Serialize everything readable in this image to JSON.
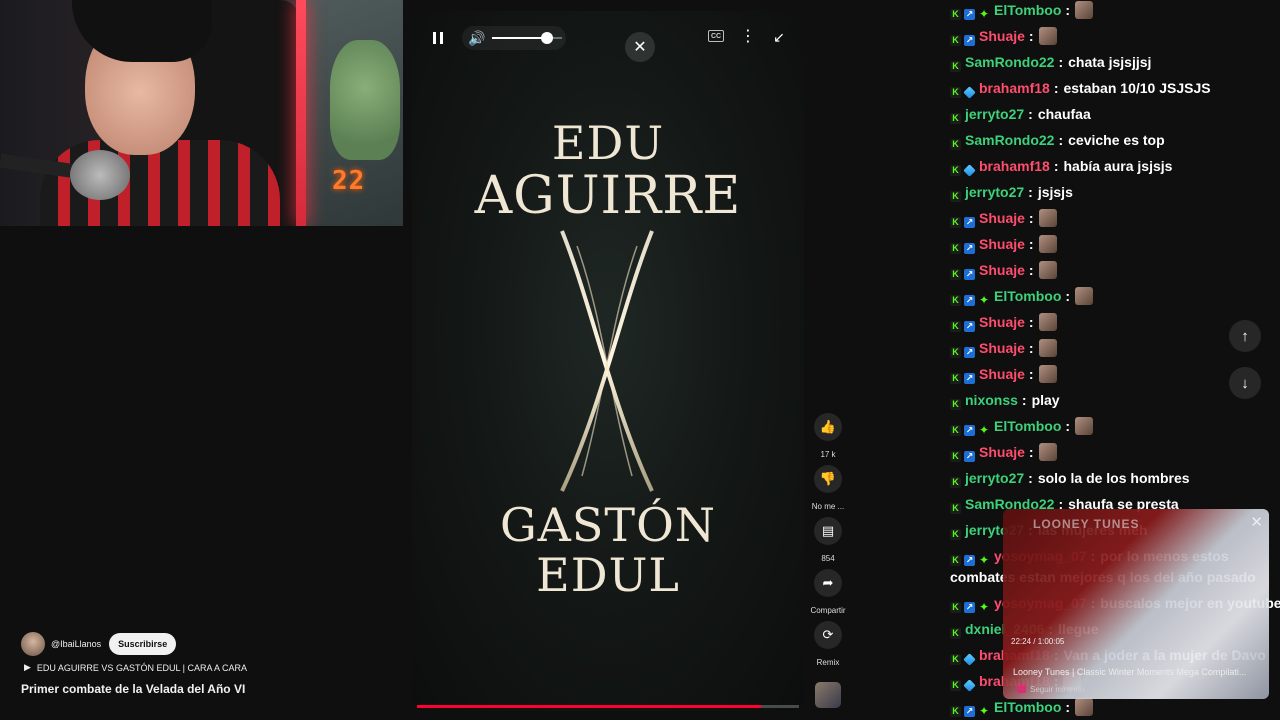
{
  "webcam": {
    "counter": "22"
  },
  "player": {
    "poster": {
      "line1": "EDU",
      "line2": "AGUIRRE",
      "line3": "GASTÓN",
      "line4": "EDUL"
    },
    "volume_level": 0.78,
    "progress": 0.9,
    "cc_label": "CC"
  },
  "actions": {
    "like_count": "17 k",
    "dislike_label": "No me ...",
    "comments_count": "854",
    "share_label": "Compartir",
    "remix_label": "Remix"
  },
  "channel": {
    "handle": "@IbaiLlanos",
    "subscribe_label": "Suscribirse",
    "playlist": "EDU AGUIRRE VS GASTÓN EDUL | CARA A CARA",
    "title": "Primer combate de la Velada del Año VI"
  },
  "chat": {
    "messages": [
      {
        "user": "ElTomboo",
        "color": "#3cd17a",
        "badges": [
          "k",
          "mod",
          "star"
        ],
        "text": "",
        "emote": true
      },
      {
        "user": "Shuaje",
        "color": "#ff4d6d",
        "badges": [
          "k",
          "mod"
        ],
        "text": "",
        "emote": true
      },
      {
        "user": "SamRondo22",
        "color": "#3cd17a",
        "badges": [
          "k"
        ],
        "text": "chata jsjsjjsj",
        "emote": false
      },
      {
        "user": "brahamf18",
        "color": "#ff4d6d",
        "badges": [
          "k",
          "cube"
        ],
        "text": "estaban 10/10 JSJSJS",
        "emote": false
      },
      {
        "user": "jerryto27",
        "color": "#3cd17a",
        "badges": [
          "k"
        ],
        "text": "chaufaa",
        "emote": false
      },
      {
        "user": "SamRondo22",
        "color": "#3cd17a",
        "badges": [
          "k"
        ],
        "text": "ceviche es top",
        "emote": false
      },
      {
        "user": "brahamf18",
        "color": "#ff4d6d",
        "badges": [
          "k",
          "cube"
        ],
        "text": "había aura jsjsjs",
        "emote": false
      },
      {
        "user": "jerryto27",
        "color": "#3cd17a",
        "badges": [
          "k"
        ],
        "text": "jsjsjs",
        "emote": false
      },
      {
        "user": "Shuaje",
        "color": "#ff4d6d",
        "badges": [
          "k",
          "mod"
        ],
        "text": "",
        "emote": true
      },
      {
        "user": "Shuaje",
        "color": "#ff4d6d",
        "badges": [
          "k",
          "mod"
        ],
        "text": "",
        "emote": true
      },
      {
        "user": "Shuaje",
        "color": "#ff4d6d",
        "badges": [
          "k",
          "mod"
        ],
        "text": "",
        "emote": true
      },
      {
        "user": "ElTomboo",
        "color": "#3cd17a",
        "badges": [
          "k",
          "mod",
          "star"
        ],
        "text": "",
        "emote": true
      },
      {
        "user": "Shuaje",
        "color": "#ff4d6d",
        "badges": [
          "k",
          "mod"
        ],
        "text": "",
        "emote": true
      },
      {
        "user": "Shuaje",
        "color": "#ff4d6d",
        "badges": [
          "k",
          "mod"
        ],
        "text": "",
        "emote": true
      },
      {
        "user": "Shuaje",
        "color": "#ff4d6d",
        "badges": [
          "k",
          "mod"
        ],
        "text": "",
        "emote": true
      },
      {
        "user": "nixonss",
        "color": "#3cd17a",
        "badges": [
          "k"
        ],
        "text": "play",
        "emote": false
      },
      {
        "user": "ElTomboo",
        "color": "#3cd17a",
        "badges": [
          "k",
          "mod",
          "star"
        ],
        "text": "",
        "emote": true
      },
      {
        "user": "Shuaje",
        "color": "#ff4d6d",
        "badges": [
          "k",
          "mod"
        ],
        "text": "",
        "emote": true
      },
      {
        "user": "jerryto27",
        "color": "#3cd17a",
        "badges": [
          "k"
        ],
        "text": "solo la de los hombres",
        "emote": false
      },
      {
        "user": "SamRondo22",
        "color": "#3cd17a",
        "badges": [
          "k"
        ],
        "text": "shaufa se presta",
        "emote": false
      },
      {
        "user": "jerryto27",
        "color": "#3cd17a",
        "badges": [
          "k"
        ],
        "text": "las mujeres meh",
        "emote": false
      },
      {
        "user": "yosoymag_07",
        "color": "#ff4d6d",
        "badges": [
          "k",
          "mod",
          "star"
        ],
        "text": "por lo menos estos",
        "emote": false
      },
      {
        "user": "yosoymag_07",
        "color": "#ff4d6d",
        "badges": [
          "k",
          "mod",
          "star"
        ],
        "text": "buscalos mejor en youtube",
        "emote": false
      },
      {
        "user": "dxniel_2406",
        "color": "#3cd17a",
        "badges": [
          "k"
        ],
        "text": "llegue",
        "emote": false
      },
      {
        "user": "brahamf18",
        "color": "#ff4d6d",
        "badges": [
          "k",
          "cube"
        ],
        "text": "Van a joder a la mujer de Davo",
        "emote": false
      },
      {
        "user": "brahamf18",
        "color": "#ff4d6d",
        "badges": [
          "k",
          "cube"
        ],
        "text": "",
        "emote": true
      },
      {
        "user": "ElTomboo",
        "color": "#3cd17a",
        "badges": [
          "k",
          "mod",
          "star"
        ],
        "text": "",
        "emote": true
      }
    ],
    "wrap_text": "combates estan mejores q los del año pasado"
  },
  "miniplayer": {
    "brand": "LOONEY TUNES",
    "time": "22:24 / 1:00:05",
    "title": "Looney Tunes | Classic Winter Moments Mega Compilati...",
    "channel": "Seguir mirando"
  },
  "icons": {
    "pause": "pause-icon",
    "volume": "volume-icon",
    "close": "close-icon",
    "like": "thumbs-up-icon",
    "dislike": "thumbs-down-icon",
    "comment": "comment-icon",
    "share": "share-icon",
    "remix": "remix-icon",
    "arrow_up": "arrow-up-icon",
    "arrow_down": "arrow-down-icon"
  }
}
